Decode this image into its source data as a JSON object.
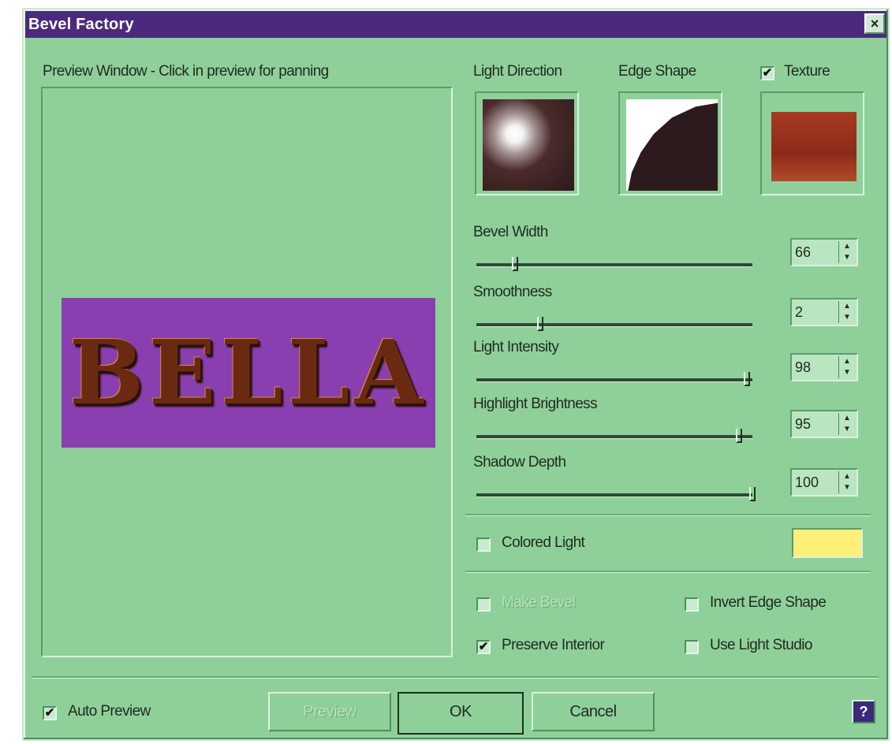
{
  "window": {
    "title": "Bevel Factory",
    "close_glyph": "×"
  },
  "preview": {
    "label": "Preview Window - Click in preview for panning",
    "sample_text": "BELLA"
  },
  "thumbs": {
    "light_direction": "Light Direction",
    "edge_shape": "Edge Shape",
    "texture": "Texture",
    "texture_checked": "✔"
  },
  "sliders": [
    {
      "label": "Bevel Width",
      "value": "66",
      "fraction": 0.14
    },
    {
      "label": "Smoothness",
      "value": "2",
      "fraction": 0.23
    },
    {
      "label": "Light Intensity",
      "value": "98",
      "fraction": 0.98
    },
    {
      "label": "Highlight Brightness",
      "value": "95",
      "fraction": 0.95
    },
    {
      "label": "Shadow Depth",
      "value": "100",
      "fraction": 1.0
    }
  ],
  "spin_arrows": {
    "up": "▲",
    "down": "▼"
  },
  "colored_light": {
    "label": "Colored Light",
    "color": "#fff07a"
  },
  "options": {
    "make_bevel": "Make Bevel",
    "invert_edge_shape": "Invert Edge Shape",
    "preserve_interior": "Preserve Interior",
    "preserve_interior_checked": "✔",
    "use_light_studio": "Use Light Studio"
  },
  "footer": {
    "auto_preview": "Auto Preview",
    "auto_preview_checked": "✔",
    "preview_button": "Preview",
    "ok_button": "OK",
    "cancel_button": "Cancel",
    "help_glyph": "?"
  },
  "colors": {
    "dialog_bg": "#8fd09a",
    "titlebar": "#4b2a7e",
    "sample_bg": "#8a3fb0"
  }
}
